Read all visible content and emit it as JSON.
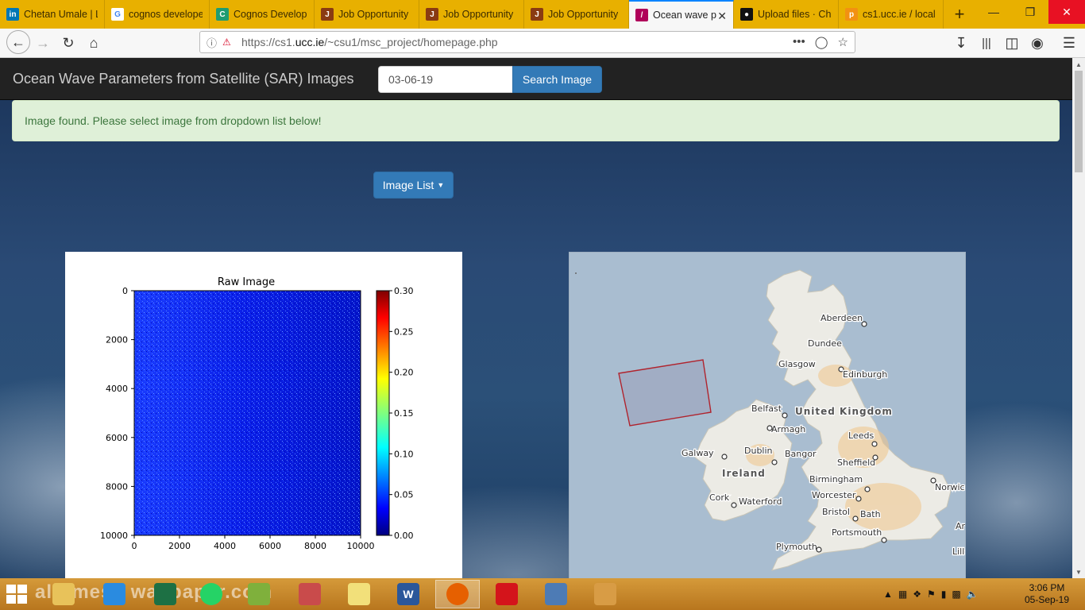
{
  "browser": {
    "tabs": [
      {
        "title": "Chetan Umale | L",
        "icon": "linkedin-icon",
        "color": "#0077b5",
        "glyph": "in"
      },
      {
        "title": "cognos develope",
        "icon": "google-icon",
        "color": "#ffffff",
        "glyph": "G"
      },
      {
        "title": "Cognos Develop",
        "icon": "cognos-icon",
        "color": "#1f9c72",
        "glyph": "C"
      },
      {
        "title": "Job Opportunity",
        "icon": "job-icon",
        "color": "#8a3b12",
        "glyph": "J"
      },
      {
        "title": "Job Opportunity",
        "icon": "job-icon",
        "color": "#8a3b12",
        "glyph": "J"
      },
      {
        "title": "Job Opportunity",
        "icon": "job-icon",
        "color": "#8a3b12",
        "glyph": "J"
      },
      {
        "title": "Ocean wave p",
        "icon": "feather-icon",
        "color": "#b0005a",
        "glyph": "/",
        "active": true
      },
      {
        "title": "Upload files · Ch",
        "icon": "github-icon",
        "color": "#111111",
        "glyph": "●"
      },
      {
        "title": "cs1.ucc.ie / local",
        "icon": "phpmyadmin-icon",
        "color": "#f29111",
        "glyph": "p"
      }
    ],
    "url_prefix": "https://cs1.",
    "url_domain": "ucc.ie",
    "url_path": "/~csu1/msc_project/homepage.php"
  },
  "site": {
    "brand": "Ocean Wave Parameters from Satellite (SAR) Images",
    "date_value": "03-06-19",
    "search_label": "Search Image",
    "alert_text": "Image found. Please select image from dropdown list below!",
    "image_list_label": "Image List"
  },
  "raw_plot": {
    "title": "Raw Image",
    "x_ticks": [
      "0",
      "2000",
      "4000",
      "6000",
      "8000",
      "10000"
    ],
    "y_ticks": [
      "0",
      "2000",
      "4000",
      "6000",
      "8000",
      "10000"
    ],
    "cbar_ticks": [
      "0.30",
      "0.25",
      "0.20",
      "0.15",
      "0.10",
      "0.05",
      "0.00"
    ]
  },
  "map": {
    "country_labels": [
      "United Kingdom",
      "Ireland"
    ],
    "cities": [
      {
        "name": "Aberdeen"
      },
      {
        "name": "Dundee"
      },
      {
        "name": "Glasgow"
      },
      {
        "name": "Edinburgh"
      },
      {
        "name": "Belfast"
      },
      {
        "name": "Armagh"
      },
      {
        "name": "Leeds"
      },
      {
        "name": "Galway"
      },
      {
        "name": "Dublin"
      },
      {
        "name": "Bangor"
      },
      {
        "name": "Sheffield"
      },
      {
        "name": "Birmingham"
      },
      {
        "name": "Norwic"
      },
      {
        "name": "Cork"
      },
      {
        "name": "Waterford"
      },
      {
        "name": "Worcester"
      },
      {
        "name": "Bristol"
      },
      {
        "name": "Bath"
      },
      {
        "name": "Portsmouth"
      },
      {
        "name": "Plymouth"
      },
      {
        "name": "Ar"
      },
      {
        "name": "Lille"
      }
    ]
  },
  "taskbar": {
    "wallpaper_text": "alltimesh wallpaper.com",
    "apps": [
      {
        "icon": "file-explorer-icon",
        "color": "#e8c25a"
      },
      {
        "icon": "internet-explorer-icon",
        "color": "#2a8be0"
      },
      {
        "icon": "excel-icon",
        "color": "#1d7044"
      },
      {
        "icon": "whatsapp-icon",
        "color": "#25d366"
      },
      {
        "icon": "notepad-icon",
        "color": "#7fb03c"
      },
      {
        "icon": "snipping-tool-icon",
        "color": "#c94b4b"
      },
      {
        "icon": "sticky-notes-icon",
        "color": "#f2e07a"
      },
      {
        "icon": "word-icon",
        "color": "#2b579a",
        "glyph": "W"
      },
      {
        "icon": "firefox-icon",
        "color": "#e66000",
        "selected": true
      },
      {
        "icon": "acrobat-icon",
        "color": "#d4141b"
      },
      {
        "icon": "windows-media-icon",
        "color": "#4d7bb5"
      },
      {
        "icon": "paint-icon",
        "color": "#d89c45"
      }
    ],
    "time": "3:06 PM",
    "date": "05-Sep-19"
  }
}
